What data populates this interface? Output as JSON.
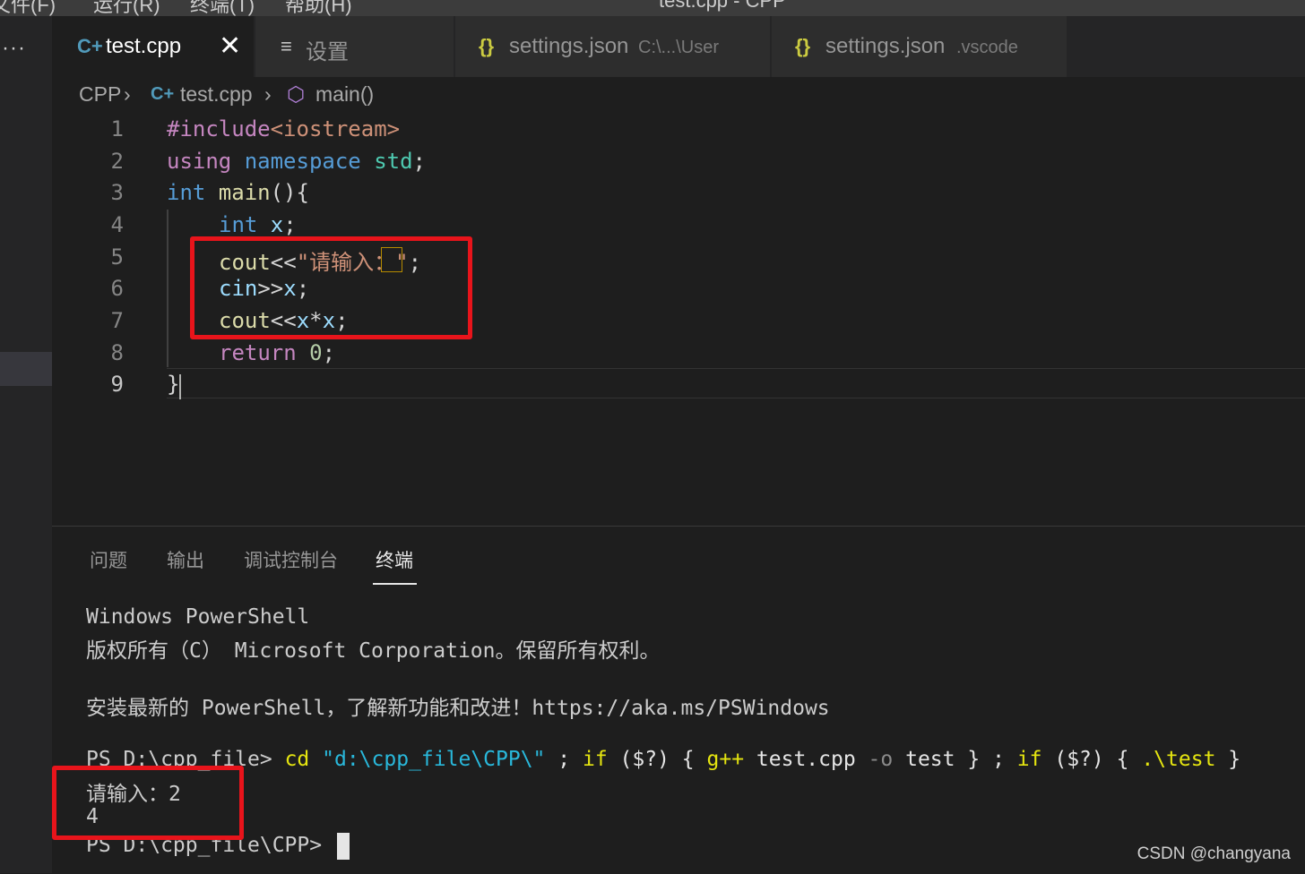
{
  "menubar": {
    "items": [
      "文件(F)",
      "运行(R)",
      "终端(T)",
      "帮助(H)"
    ],
    "title_fragment": "test.cpp - CPP"
  },
  "activity": {
    "more_label": "···"
  },
  "tabs": [
    {
      "icon": "C+",
      "label": "test.cpp",
      "close": "✕",
      "active": true
    },
    {
      "icon": "≡",
      "label": "设置",
      "active": false
    },
    {
      "icon": "{}",
      "label": "settings.json",
      "desc": "C:\\...\\User",
      "active": false
    },
    {
      "icon": "{}",
      "label": "settings.json",
      "desc": ".vscode",
      "active": false
    }
  ],
  "breadcrumb": {
    "folder": "CPP",
    "sep": "›",
    "file_icon": "C+",
    "file": "test.cpp",
    "symbol_icon": "⬡",
    "symbol": "main()"
  },
  "editor": {
    "line_numbers": [
      "1",
      "2",
      "3",
      "4",
      "5",
      "6",
      "7",
      "8",
      "9"
    ],
    "current_line": "9",
    "lines": [
      {
        "t1": "#include",
        "t2": "<iostream>"
      },
      {
        "t1": "using",
        "t2": " namespace",
        "t3": " std",
        "t4": ";"
      },
      {
        "t1": "int",
        "t2": " main",
        "t3": "(){"
      },
      {
        "t1": "int",
        "t2": " x",
        "t3": ";"
      },
      {
        "t1": "cout",
        "t2": "<<",
        "t3": "\"请输入：\"",
        "t4": ";"
      },
      {
        "t1": "cin",
        "t2": ">>",
        "t3": "x",
        "t4": ";"
      },
      {
        "t1": "cout",
        "t2": "<<",
        "t3": "x",
        "t4": "*",
        "t5": "x",
        "t6": ";"
      },
      {
        "t1": "return",
        "t2": " 0",
        "t3": ";"
      },
      {
        "t1": "}"
      }
    ]
  },
  "panel": {
    "tabs": [
      "问题",
      "输出",
      "调试控制台",
      "终端"
    ],
    "active_tab": "终端",
    "terminal": {
      "l1": "Windows PowerShell",
      "l2": "版权所有（C） Microsoft Corporation。保留所有权利。",
      "l3": "安装最新的 PowerShell，了解新功能和改进！https://aka.ms/PSWindows",
      "prompt": "PS D:\\cpp_file>",
      "cmd_cd": "cd",
      "cmd_path": "\"d:\\cpp_file\\CPP\\\"",
      "cmd_sep1": ";",
      "cmd_if1": "if",
      "cmd_cond1": "($?)",
      "cmd_brace1": "{",
      "cmd_gpp": "g++",
      "cmd_file": "test.cpp",
      "cmd_o": "-o",
      "cmd_out": "test",
      "cmd_brace2": "}",
      "cmd_sep2": ";",
      "cmd_if2": "if",
      "cmd_cond2": "($?)",
      "cmd_brace3": "{",
      "cmd_run": ".\\test",
      "cmd_brace4": "}",
      "out1": "请输入：2",
      "out2": "4",
      "prompt2": "PS D:\\cpp_file\\CPP>"
    }
  },
  "watermark": "CSDN @changyana",
  "colors": {
    "highlight_box": "#e8141b",
    "keyword": "#569cd6",
    "control": "#c586c0",
    "string": "#ce9178"
  }
}
